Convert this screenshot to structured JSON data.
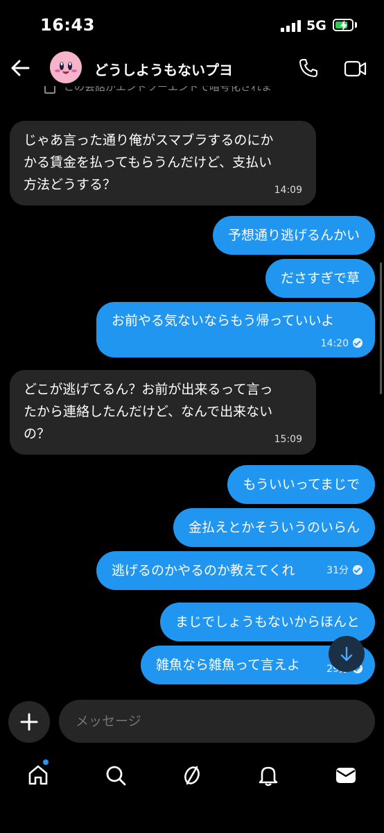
{
  "status_bar": {
    "time": "16:43",
    "network": "5G"
  },
  "header": {
    "title": "どうしようもないプヨ",
    "encryption_notice": "この会話がエンドツーエンドで暗号化されました"
  },
  "messages": [
    {
      "from": "other",
      "text": [
        "じゃあ言った通り俺がスマブラするのにか",
        "かる賃金を払ってもらうんだけど、支払い",
        "方法どうする？"
      ],
      "time": "14:09"
    },
    {
      "from": "me",
      "text": "予想通り逃げるんかい"
    },
    {
      "from": "me",
      "text": "ださすぎで草"
    },
    {
      "from": "me",
      "text": "お前やる気ないならもう帰っていいよ",
      "time": "14:20"
    },
    {
      "from": "other",
      "text": [
        "どこが逃げてるん？お前が出来るって言っ",
        "たから連絡したんだけど、なんで出来ない",
        "の？"
      ],
      "time": "15:09"
    },
    {
      "from": "me",
      "text": "もういいってまじで"
    },
    {
      "from": "me",
      "text": "金払えとかそういうのいらん"
    },
    {
      "from": "me",
      "text": "逃げるのかやるのか教えてくれ",
      "time": "31分"
    },
    {
      "from": "me",
      "text": "まじでしょうもないからほんと"
    },
    {
      "from": "me",
      "text": "雑魚なら雑魚って言えよ",
      "time": "29分"
    }
  ],
  "composer": {
    "placeholder": "メッセージ"
  },
  "nav": [
    "home-icon",
    "search-icon",
    "threads-icon",
    "bell-icon",
    "inbox-icon"
  ],
  "colors": {
    "accent": "#2196f0",
    "received_bubble": "#262626",
    "background": "#000000",
    "avatar": "#f6b3cc",
    "battery": "#34c759"
  }
}
